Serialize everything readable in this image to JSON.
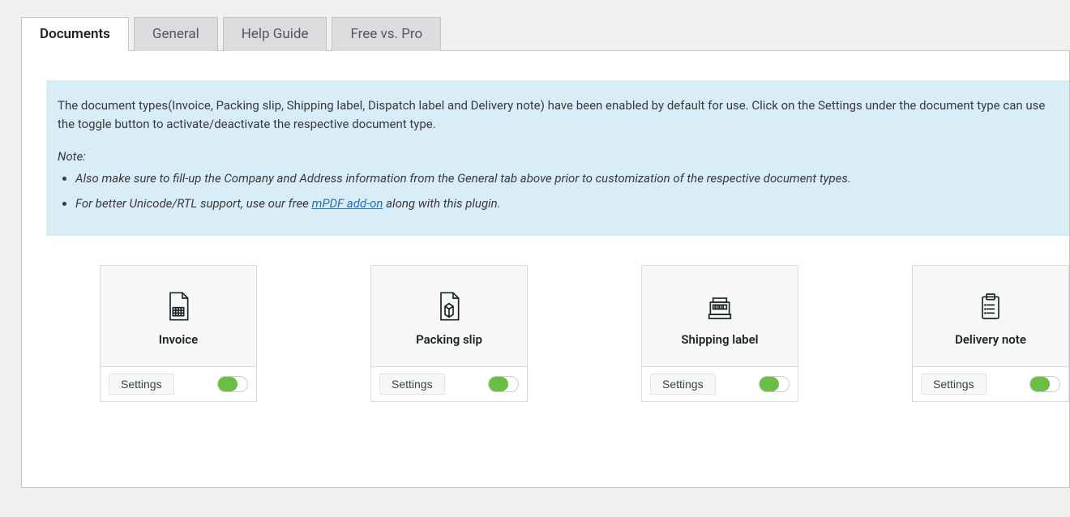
{
  "tabs": [
    {
      "label": "Documents",
      "active": true
    },
    {
      "label": "General",
      "active": false
    },
    {
      "label": "Help Guide",
      "active": false
    },
    {
      "label": "Free vs. Pro",
      "active": false
    }
  ],
  "info": {
    "intro": "The document types(Invoice, Packing slip, Shipping label, Dispatch label and Delivery note) have been enabled by default for use. Click on the Settings under the document type can use the toggle button to activate/deactivate the respective document type.",
    "note_label": "Note:",
    "note1": "Also make sure to fill-up the Company and Address information from the General tab above prior to customization of the respective document types.",
    "note2_pre": "For better Unicode/RTL support, use our free ",
    "note2_link": "mPDF add-on",
    "note2_post": " along with this plugin."
  },
  "cards": [
    {
      "title": "Invoice",
      "settings": "Settings",
      "enabled": true,
      "icon": "invoice"
    },
    {
      "title": "Packing slip",
      "settings": "Settings",
      "enabled": true,
      "icon": "packing"
    },
    {
      "title": "Shipping label",
      "settings": "Settings",
      "enabled": true,
      "icon": "shipping"
    },
    {
      "title": "Delivery note",
      "settings": "Settings",
      "enabled": true,
      "icon": "delivery"
    }
  ]
}
